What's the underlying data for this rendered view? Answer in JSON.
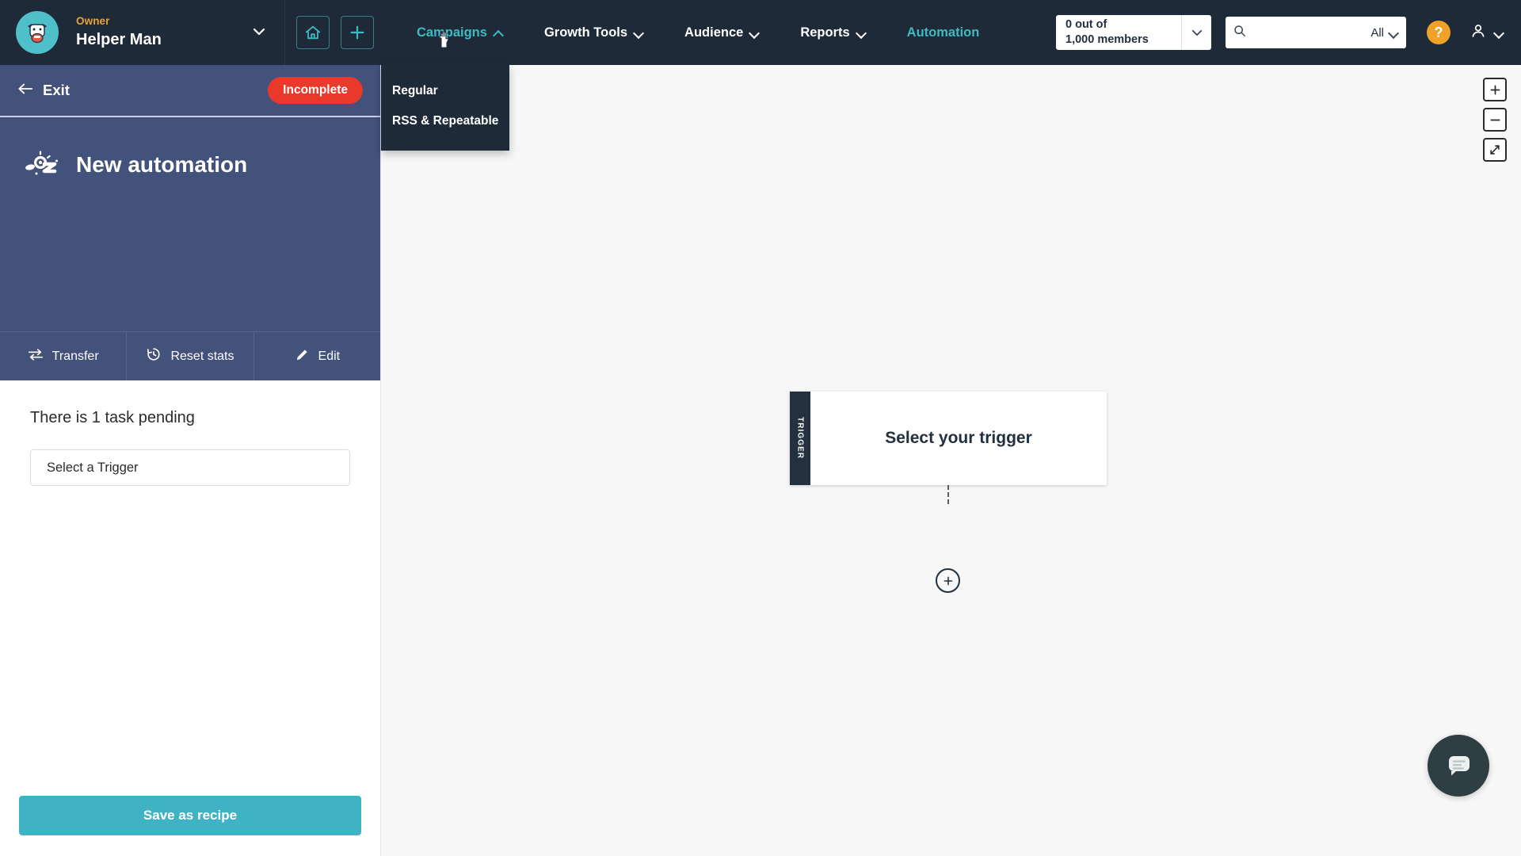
{
  "header": {
    "brand": {
      "role_label": "Owner",
      "account_name": "Helper Man",
      "avatar_icon": "cow-avatar-icon",
      "caret_icon": "chevron-down-icon"
    },
    "quick_actions": [
      {
        "name": "home-button",
        "icon": "home-icon"
      },
      {
        "name": "create-button",
        "icon": "plus-icon"
      }
    ],
    "nav": [
      {
        "label": "Campaigns",
        "icon": "chevron-up-icon",
        "state": "active"
      },
      {
        "label": "Growth Tools",
        "icon": "chevron-down-icon",
        "state": "default"
      },
      {
        "label": "Audience",
        "icon": "chevron-down-icon",
        "state": "default"
      },
      {
        "label": "Reports",
        "icon": "chevron-down-icon",
        "state": "default"
      },
      {
        "label": "Automation",
        "icon": "",
        "state": "teal"
      }
    ],
    "members": {
      "line1": "0 out of",
      "line2": "1,000 members",
      "caret_icon": "chevron-down-icon"
    },
    "search": {
      "value": "",
      "placeholder": "",
      "icon": "search-icon",
      "scope_label": "All",
      "scope_caret_icon": "chevron-down-icon"
    },
    "help_label": "?",
    "account": {
      "icon": "person-icon",
      "caret_icon": "chevron-down-icon"
    }
  },
  "campaigns_dropdown": {
    "open": true,
    "items": [
      {
        "label": "Regular"
      },
      {
        "label": "RSS & Repeatable"
      }
    ]
  },
  "left_panel": {
    "exit_label": "Exit",
    "exit_icon": "arrow-left-icon",
    "status_badge": "Incomplete",
    "hero": {
      "icon": "automation-wand-icon",
      "title": "New automation"
    },
    "tools": [
      {
        "label": "Transfer",
        "icon": "transfer-icon"
      },
      {
        "label": "Reset stats",
        "icon": "history-clock-icon"
      },
      {
        "label": "Edit",
        "icon": "pencil-icon"
      }
    ],
    "task_status": "There is 1 task pending",
    "trigger_select_label": "Select a Trigger",
    "save_recipe_label": "Save as recipe"
  },
  "canvas": {
    "zoom_controls": [
      {
        "name": "zoom-in-button",
        "glyph": "+"
      },
      {
        "name": "zoom-out-button",
        "glyph": "−"
      },
      {
        "name": "fit-screen-button",
        "glyph": "⤢"
      }
    ],
    "trigger_node": {
      "tab_label": "TRIGGER",
      "title": "Select your trigger"
    },
    "add_step_glyph": "+",
    "chat_icon": "chat-bubble-icon"
  },
  "colors": {
    "nav_bg": "#1f2a38",
    "panel_header_bg": "#42527a",
    "accent_teal": "#3fb9c4",
    "badge_red": "#e8392b",
    "role_amber": "#e6a33c",
    "canvas_bg": "#f7f7f7",
    "node_dark": "#22303f"
  }
}
